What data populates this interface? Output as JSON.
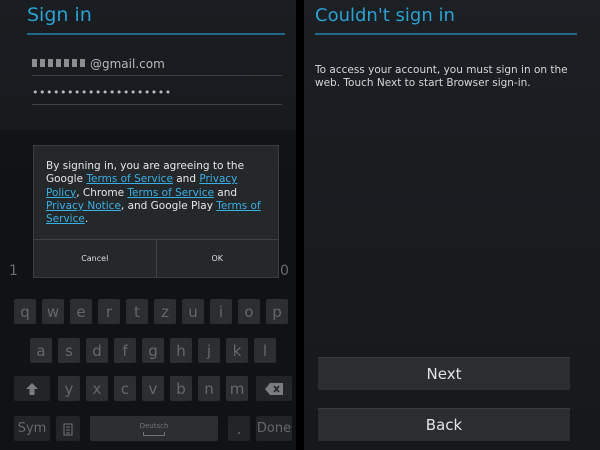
{
  "signin": {
    "title": "Sign in",
    "email_suffix": "@gmail.com",
    "password_mask": "••••••••••••••••••••",
    "dialog": {
      "text_1": "By signing in, you are agreeing to the Google ",
      "link_tos": "Terms of Service",
      "text_2": " and ",
      "link_privacy": "Privacy Policy",
      "text_3": ", Chrome ",
      "link_chrome_tos": "Terms of Service",
      "text_4": " and ",
      "link_privacy_notice": "Privacy Notice",
      "text_5": ", and Google Play ",
      "link_play_tos": "Terms of Service",
      "text_6": ".",
      "cancel": "Cancel",
      "ok": "OK"
    }
  },
  "keyboard": {
    "num_left": "1",
    "num_right": "0",
    "row1": [
      "q",
      "w",
      "e",
      "r",
      "t",
      "z",
      "u",
      "i",
      "o",
      "p"
    ],
    "row2": [
      "a",
      "s",
      "d",
      "f",
      "g",
      "h",
      "j",
      "k",
      "l"
    ],
    "row3": [
      "y",
      "x",
      "c",
      "v",
      "b",
      "n",
      "m"
    ],
    "sym": "Sym",
    "space_label": "Deutsch",
    "period": ".",
    "done": "Done"
  },
  "couldnt": {
    "title": "Couldn't sign in",
    "message": "To access your account, you must sign in on the web. Touch Next to start Browser sign-in.",
    "next": "Next",
    "back": "Back"
  }
}
